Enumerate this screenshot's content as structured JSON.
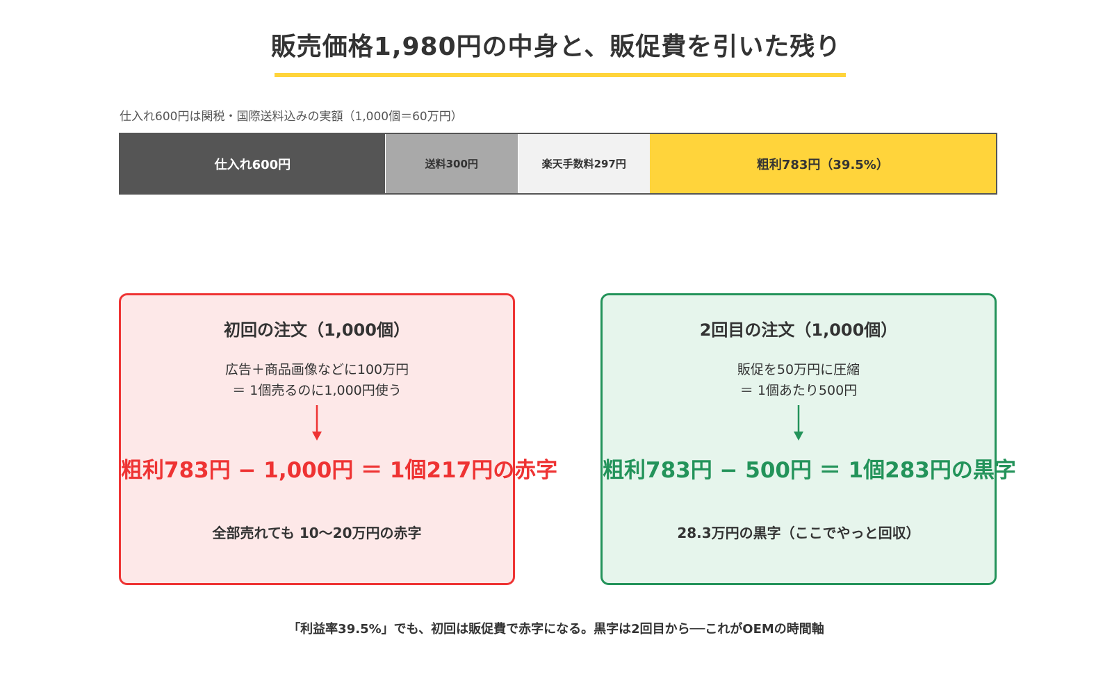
{
  "title": "販売価格1,980円の中身と、販促費を引いた残り",
  "bar_note": "仕入れ600円は関税・国際送料込みの実額（1,000個＝60万円）",
  "cost_breakdown": {
    "total": 1980,
    "segments": [
      {
        "label": "仕入れ600円",
        "value": 600,
        "color": "#555555"
      },
      {
        "label": "送料300円",
        "value": 300,
        "color": "#a9a9a9"
      },
      {
        "label": "楽天手数料297円",
        "value": 297,
        "color": "#f2f2f2"
      },
      {
        "label": "粗利783円（39.5%）",
        "value": 783,
        "color": "#ffd43b"
      }
    ]
  },
  "first_order": {
    "title": "初回の注文（1,000個）",
    "desc_line1": "広告＋商品画像などに100万円",
    "desc_line2": "＝ 1個売るのに1,000円使う",
    "formula": "粗利783円 − 1,000円 ＝ 1個217円の赤字",
    "result": "全部売れても 10〜20万円の赤字",
    "accent_color": "#ee3333"
  },
  "second_order": {
    "title": "2回目の注文（1,000個）",
    "desc_line1": "販促を50万円に圧縮",
    "desc_line2": "＝ 1個あたり500円",
    "formula": "粗利783円 − 500円 ＝ 1個283円の黒字",
    "result": "28.3万円の黒字（ここでやっと回収）",
    "accent_color": "#23935a"
  },
  "footer_note": "「利益率39.5%」でも、初回は販促費で赤字になる。黒字は2回目から──これがOEMの時間軸"
}
